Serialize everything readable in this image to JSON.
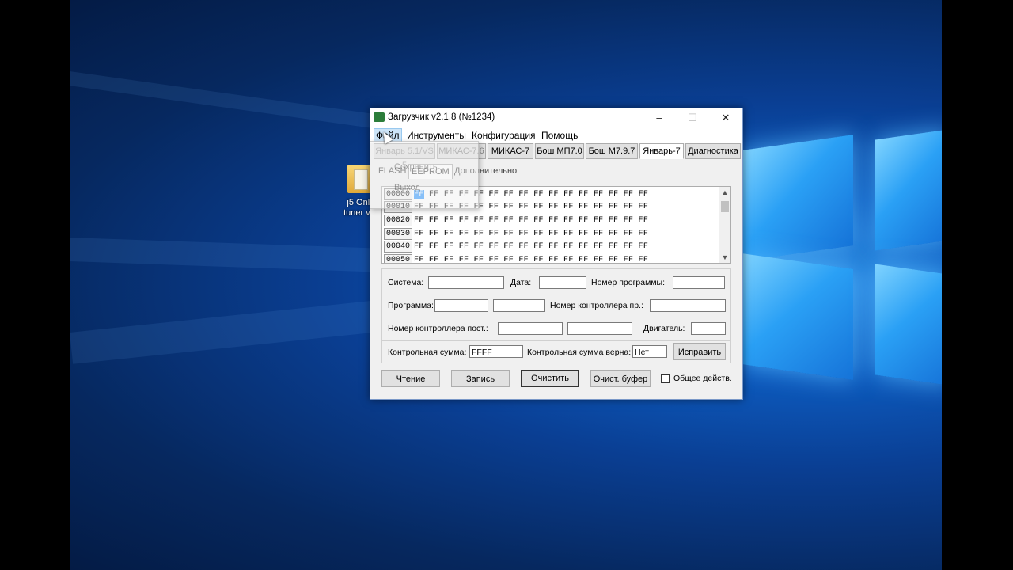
{
  "desktop": {
    "icon_label_line1": "j5 Onli",
    "icon_label_line2": "tuner v1"
  },
  "window": {
    "title": "Загрузчик v2.1.8 (№1234)",
    "buttons": {
      "minimize": "–",
      "maximize": "☐",
      "close": "✕"
    }
  },
  "menu": [
    "Файл",
    "Инструменты",
    "Конфигурация",
    "Помощь"
  ],
  "file_menu_items": [
    "Сохранить",
    "Выход"
  ],
  "ecu_tabs": [
    "Январь 5.1/VS 5",
    "МИКАС-7.6",
    "МИКАС-7",
    "Бош МП7.0",
    "Бош М7.9.7",
    "Январь-7",
    "Диагностика"
  ],
  "selected_ecu_tab": "Январь-7",
  "sub_tabs": [
    "FLASH",
    "EEPROM",
    "Дополнительно"
  ],
  "hex": {
    "rows": [
      {
        "addr": "00000",
        "first": "FF",
        "data": "FF FF FF FF FF FF FF FF FF FF FF FF FF FF FF"
      },
      {
        "addr": "00010",
        "first": "",
        "data": "FF FF FF FF FF FF FF FF FF FF FF FF FF FF FF FF"
      },
      {
        "addr": "00020",
        "first": "",
        "data": "FF FF FF FF FF FF FF FF FF FF FF FF FF FF FF FF"
      },
      {
        "addr": "00030",
        "first": "",
        "data": "FF FF FF FF FF FF FF FF FF FF FF FF FF FF FF FF"
      },
      {
        "addr": "00040",
        "first": "",
        "data": "FF FF FF FF FF FF FF FF FF FF FF FF FF FF FF FF"
      },
      {
        "addr": "00050",
        "first": "",
        "data": "FF FF FF FF FF FF FF FF FF FF FF FF FF FF FF FF"
      }
    ]
  },
  "info": {
    "system_label": "Система:",
    "date_label": "Дата:",
    "program_number_label": "Номер программы:",
    "program_label": "Программа:",
    "controller_number_label": "Номер контроллера пр.:",
    "controller_post_label": "Номер контроллера пост.:",
    "engine_label": "Двигатель:",
    "checksum_label": "Контрольная сумма:",
    "checksum_value": "FFFF",
    "checksum_ok_label": "Контрольная сумма верна:",
    "checksum_ok_value": "Нет",
    "fix_button": "Исправить"
  },
  "actions": {
    "read": "Чтение",
    "write": "Запись",
    "clear": "Очистить",
    "clear_buffer": "Очист. буфер",
    "common_action_label": "Общее действ."
  }
}
